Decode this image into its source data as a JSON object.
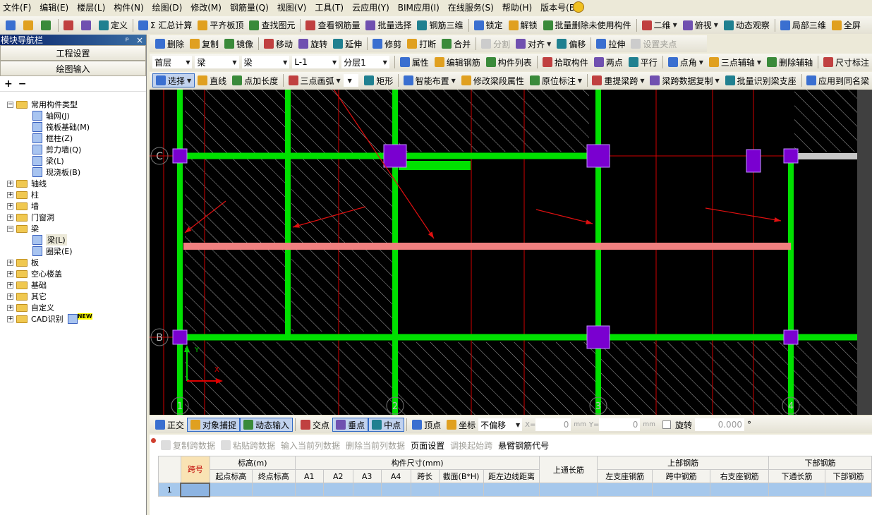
{
  "menu": [
    "文件(F)",
    "编辑(E)",
    "楼层(L)",
    "构件(N)",
    "绘图(D)",
    "修改(M)",
    "钢筋量(Q)",
    "视图(V)",
    "工具(T)",
    "云应用(Y)",
    "BIM应用(I)",
    "在线服务(S)",
    "帮助(H)",
    "版本号(B)"
  ],
  "toolbar1": [
    {
      "label": "",
      "icon": "new-file-icon"
    },
    {
      "label": "",
      "icon": "open-folder-icon"
    },
    {
      "label": "",
      "icon": "save-icon"
    },
    {
      "label": "",
      "icon": "undo-icon"
    },
    {
      "label": "",
      "icon": "redo-icon"
    },
    {
      "label": "定义",
      "icon": "define-icon"
    },
    {
      "label": "Σ 汇总计算",
      "icon": "sum-icon"
    },
    {
      "label": "平齐板顶",
      "icon": "align-slab-icon"
    },
    {
      "label": "查找图元",
      "icon": "binoculars-icon"
    },
    {
      "label": "查看钢筋量",
      "icon": "glasses-icon"
    },
    {
      "label": "批量选择",
      "icon": "batch-select-icon"
    },
    {
      "label": "钢筋三维",
      "icon": "rebar-3d-icon"
    },
    {
      "label": "锁定",
      "icon": "lock-icon"
    },
    {
      "label": "解锁",
      "icon": "unlock-icon"
    },
    {
      "label": "批量删除未使用构件",
      "icon": "batch-delete-icon"
    },
    {
      "label": "二维",
      "icon": "2d-view-icon",
      "dropdown": true
    },
    {
      "label": "俯视",
      "icon": "top-view-icon",
      "dropdown": true
    },
    {
      "label": "动态观察",
      "icon": "orbit-icon"
    },
    {
      "label": "局部三维",
      "icon": "local-3d-icon"
    },
    {
      "label": "全屏",
      "icon": "zoom-all-icon"
    }
  ],
  "nav": {
    "title": "模块导航栏",
    "pin": "ᵖ",
    "close": "×",
    "buttons": [
      "工程设置",
      "绘图输入"
    ],
    "expand": "+",
    "collapse": "−",
    "tree": [
      {
        "label": "常用构件类型",
        "level": 0,
        "type": "folder-open",
        "pm": "−"
      },
      {
        "label": "轴网(J)",
        "level": 1,
        "type": "leaf"
      },
      {
        "label": "筏板基础(M)",
        "level": 1,
        "type": "leaf"
      },
      {
        "label": "框柱(Z)",
        "level": 1,
        "type": "leaf"
      },
      {
        "label": "剪力墙(Q)",
        "level": 1,
        "type": "leaf"
      },
      {
        "label": "梁(L)",
        "level": 1,
        "type": "leaf"
      },
      {
        "label": "现浇板(B)",
        "level": 1,
        "type": "leaf"
      },
      {
        "label": "轴线",
        "level": 0,
        "type": "folder",
        "pm": "+"
      },
      {
        "label": "柱",
        "level": 0,
        "type": "folder",
        "pm": "+"
      },
      {
        "label": "墙",
        "level": 0,
        "type": "folder",
        "pm": "+"
      },
      {
        "label": "门窗洞",
        "level": 0,
        "type": "folder",
        "pm": "+"
      },
      {
        "label": "梁",
        "level": 0,
        "type": "folder-open",
        "pm": "−"
      },
      {
        "label": "梁(L)",
        "level": 1,
        "type": "leaf",
        "selected": true
      },
      {
        "label": "圈梁(E)",
        "level": 1,
        "type": "leaf"
      },
      {
        "label": "板",
        "level": 0,
        "type": "folder",
        "pm": "+"
      },
      {
        "label": "空心楼盖",
        "level": 0,
        "type": "folder",
        "pm": "+"
      },
      {
        "label": "基础",
        "level": 0,
        "type": "folder",
        "pm": "+"
      },
      {
        "label": "其它",
        "level": 0,
        "type": "folder",
        "pm": "+"
      },
      {
        "label": "自定义",
        "level": 0,
        "type": "folder",
        "pm": "+"
      },
      {
        "label": "CAD识别",
        "level": 0,
        "type": "folder",
        "pm": "+",
        "badge": "NEW"
      }
    ]
  },
  "toolbar2": [
    {
      "label": "删除",
      "icon": "eraser-icon"
    },
    {
      "label": "复制",
      "icon": "copy-icon"
    },
    {
      "label": "镜像",
      "icon": "mirror-icon"
    },
    {
      "label": "移动",
      "icon": "move-icon"
    },
    {
      "label": "旋转",
      "icon": "rotate-icon"
    },
    {
      "label": "延伸",
      "icon": "extend-icon"
    },
    {
      "label": "修剪",
      "icon": "trim-icon"
    },
    {
      "label": "打断",
      "icon": "break-icon"
    },
    {
      "label": "合并",
      "icon": "merge-icon"
    },
    {
      "label": "分割",
      "icon": "split-icon",
      "disabled": true
    },
    {
      "label": "对齐",
      "icon": "align-icon",
      "dropdown": true
    },
    {
      "label": "偏移",
      "icon": "offset-icon"
    },
    {
      "label": "拉伸",
      "icon": "stretch-icon"
    },
    {
      "label": "设置夹点",
      "icon": "grip-icon",
      "disabled": true
    }
  ],
  "selectors": {
    "floor": "首层",
    "category": "梁",
    "type": "梁",
    "name": "L-1",
    "layer": "分层1"
  },
  "toolbar3": [
    {
      "label": "属性",
      "icon": "properties-icon"
    },
    {
      "label": "编辑钢筋",
      "icon": "edit-rebar-icon"
    },
    {
      "label": "构件列表",
      "icon": "list-icon"
    },
    {
      "label": "拾取构件",
      "icon": "pick-icon"
    },
    {
      "label": "两点",
      "icon": "two-point-icon"
    },
    {
      "label": "平行",
      "icon": "parallel-icon"
    },
    {
      "label": "点角",
      "icon": "point-angle-icon",
      "dropdown": true
    },
    {
      "label": "三点辅轴",
      "icon": "three-point-axis-icon",
      "dropdown": true
    },
    {
      "label": "删除辅轴",
      "icon": "delete-axis-icon"
    },
    {
      "label": "尺寸标注",
      "icon": "dimension-icon"
    }
  ],
  "toolbar4": [
    {
      "label": "选择",
      "icon": "cursor-icon",
      "active": true,
      "dropdown": true
    },
    {
      "label": "直线",
      "icon": "line-icon"
    },
    {
      "label": "点加长度",
      "icon": "point-length-icon"
    },
    {
      "label": "三点画弧",
      "icon": "arc-icon",
      "dropdown": true
    },
    {
      "label": "",
      "icon": "blank-select",
      "select": true
    },
    {
      "label": "矩形",
      "icon": "rectangle-icon"
    },
    {
      "label": "智能布置",
      "icon": "smart-layout-icon",
      "dropdown": true
    },
    {
      "label": "修改梁段属性",
      "icon": "modify-beam-icon"
    },
    {
      "label": "原位标注",
      "icon": "in-situ-annotation-icon",
      "dropdown": true
    },
    {
      "label": "重提梁跨",
      "icon": "beam-span-icon",
      "dropdown": true
    },
    {
      "label": "梁跨数据复制",
      "icon": "brush-icon",
      "dropdown": true
    },
    {
      "label": "批量识别梁支座",
      "icon": "batch-support-icon"
    },
    {
      "label": "应用到同名梁",
      "icon": "apply-icon"
    }
  ],
  "canvas": {
    "axes_rows": [
      "C",
      "B"
    ],
    "axes_cols": [
      "1",
      "2",
      "3",
      "4"
    ],
    "ucs": {
      "x": "X",
      "y": "Y"
    },
    "colors": {
      "beam": "#00e000",
      "selected_beam": "#f08080",
      "column": "#7a00d0",
      "grid": "#d00000",
      "hatch": "#bbbbbb"
    }
  },
  "snapbar": {
    "items": [
      {
        "label": "正交",
        "icon": "ortho-icon"
      },
      {
        "label": "对象捕捉",
        "icon": "snap-icon",
        "active": true
      },
      {
        "label": "动态输入",
        "icon": "dynamic-input-icon",
        "active": true
      },
      {
        "label": "交点",
        "icon": "intersection-icon"
      },
      {
        "label": "垂点",
        "icon": "perpendicular-icon",
        "active": true
      },
      {
        "label": "中点",
        "icon": "midpoint-icon",
        "active": true
      },
      {
        "label": "顶点",
        "icon": "vertex-icon"
      },
      {
        "label": "坐标",
        "icon": "coordinate-icon"
      }
    ],
    "offset": "不偏移",
    "x_label": "X=",
    "x_value": "0",
    "y_label": "Y=",
    "y_value": "0",
    "unit": "mm",
    "rotate_label": "旋转",
    "rotate_value": "0.000",
    "degree": "°"
  },
  "gridtoolbar": [
    {
      "label": "复制跨数据",
      "disabled": true
    },
    {
      "label": "粘贴跨数据",
      "disabled": true
    },
    {
      "label": "输入当前列数据",
      "disabled": true
    },
    {
      "label": "删除当前列数据",
      "disabled": true
    },
    {
      "label": "页面设置"
    },
    {
      "label": "调换起始跨",
      "disabled": true
    },
    {
      "label": "悬臂钢筋代号"
    }
  ],
  "table": {
    "span_no": "跨号",
    "elev": "标高(m)",
    "size": "构件尺寸(mm)",
    "top_through": "上通长筋",
    "top_rebar": "上部钢筋",
    "bottom_rebar": "下部钢筋",
    "subheaders": [
      "起点标高",
      "终点标高",
      "A1",
      "A2",
      "A3",
      "A4",
      "跨长",
      "截面(B*H)",
      "距左边线距离",
      "左支座钢筋",
      "跨中钢筋",
      "右支座钢筋",
      "下通长筋",
      "下部钢筋"
    ],
    "rows": [
      {
        "index": "1"
      }
    ]
  }
}
